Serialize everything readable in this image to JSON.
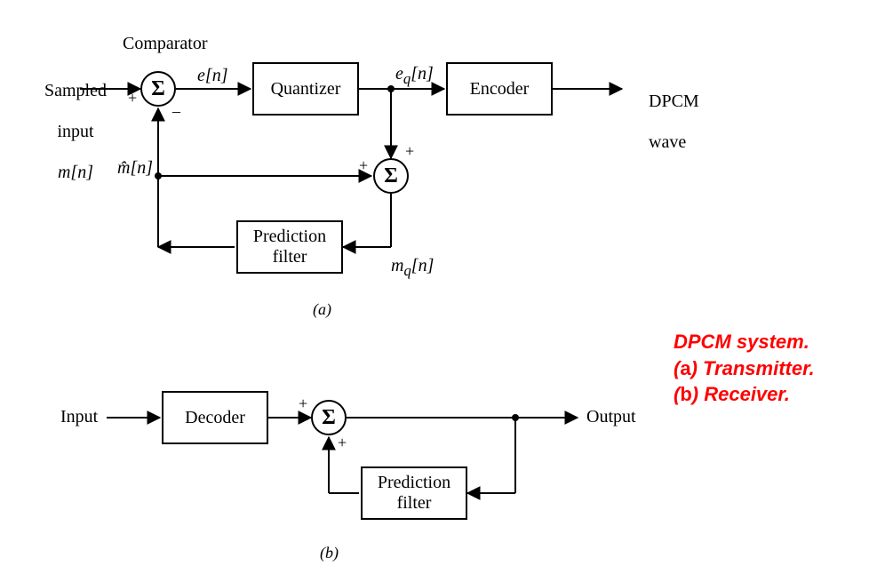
{
  "title": "DPCM system block diagram",
  "caption": {
    "line1": "DPCM system.",
    "line2": "(a) Transmitter.",
    "line3": "(b) Receiver."
  },
  "subfig": {
    "a": "(a)",
    "b": "(b)"
  },
  "transmitter": {
    "comparator_label": "Comparator",
    "input_label_line1": "Sampled",
    "input_label_line2": "input",
    "input_symbol": "m[n]",
    "error_symbol": "e[n]",
    "eq_symbol_html": "e_q[n]",
    "mhat_symbol": "m̂[n]",
    "mq_symbol_html": "m_q[n]",
    "quantizer": "Quantizer",
    "encoder": "Encoder",
    "prediction_filter": "Prediction\nfilter",
    "output_label_line1": "DPCM",
    "output_label_line2": "wave",
    "sum_symbol": "Σ",
    "signs": {
      "plus": "+",
      "minus": "–"
    }
  },
  "receiver": {
    "input_label": "Input",
    "decoder": "Decoder",
    "prediction_filter": "Prediction\nfilter",
    "output_label": "Output",
    "sum_symbol": "Σ",
    "signs": {
      "plus": "+"
    }
  }
}
